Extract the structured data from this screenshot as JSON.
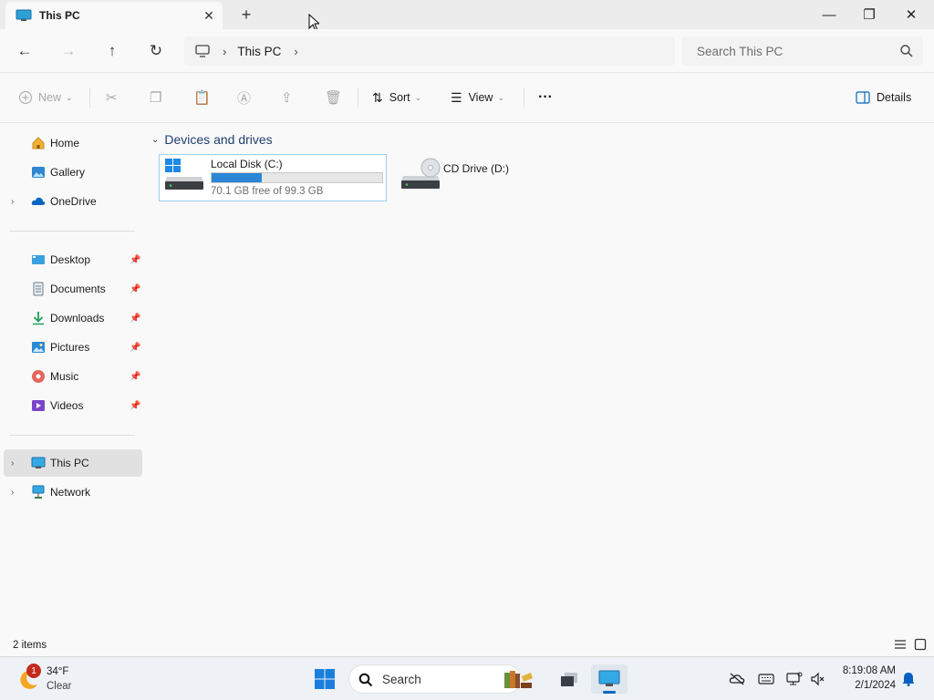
{
  "window": {
    "tab_title": "This PC",
    "new_tab_symbol": "+",
    "close_tab_symbol": "✕",
    "controls": {
      "minimize": "—",
      "maximize": "❐",
      "close": "✕"
    }
  },
  "address": {
    "breadcrumbs": [
      "This PC"
    ],
    "search_placeholder": "Search This PC"
  },
  "commands": {
    "new_label": "New",
    "sort_label": "Sort",
    "view_label": "View",
    "more_label": "···",
    "details_label": "Details"
  },
  "sidebar": {
    "quick": [
      {
        "label": "Home",
        "icon": "home-icon",
        "expandable": false
      },
      {
        "label": "Gallery",
        "icon": "gallery-icon",
        "expandable": false
      },
      {
        "label": "OneDrive",
        "icon": "onedrive-icon",
        "expandable": true
      }
    ],
    "pinned": [
      {
        "label": "Desktop",
        "icon": "desktop-icon"
      },
      {
        "label": "Documents",
        "icon": "documents-icon"
      },
      {
        "label": "Downloads",
        "icon": "downloads-icon"
      },
      {
        "label": "Pictures",
        "icon": "pictures-icon"
      },
      {
        "label": "Music",
        "icon": "music-icon"
      },
      {
        "label": "Videos",
        "icon": "videos-icon"
      }
    ],
    "locations": [
      {
        "label": "This PC",
        "icon": "this-pc-icon",
        "selected": true
      },
      {
        "label": "Network",
        "icon": "network-icon",
        "selected": false
      }
    ]
  },
  "content": {
    "group_title": "Devices and drives",
    "drives": [
      {
        "name": "Local Disk (C:)",
        "free_text": "70.1 GB free of 99.3 GB",
        "used_fraction": 0.294,
        "icon": "local-disk-icon"
      },
      {
        "name": "CD Drive (D:)",
        "icon": "cd-drive-icon"
      }
    ]
  },
  "status": {
    "item_count": "2 items"
  },
  "taskbar": {
    "weather": {
      "temp": "34°F",
      "condition": "Clear",
      "badge": "1"
    },
    "search_label": "Search",
    "time": "8:19:08 AM",
    "date": "2/1/2024"
  },
  "colors": {
    "accent": "#0067c0",
    "drive_bar": "#2b87d6",
    "selection": "#e1e1e1"
  }
}
